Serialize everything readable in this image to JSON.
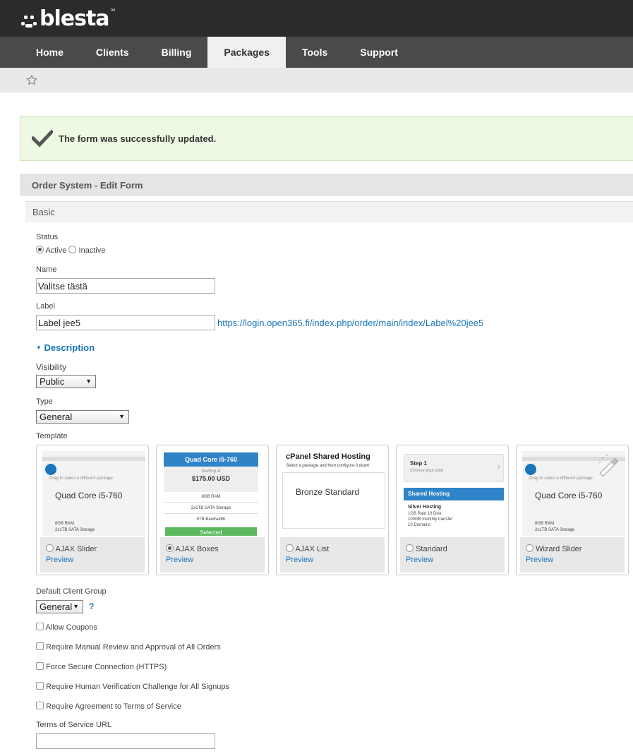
{
  "brand": {
    "name": "blesta",
    "tm": "™"
  },
  "nav": {
    "items": [
      "Home",
      "Clients",
      "Billing",
      "Packages",
      "Tools",
      "Support"
    ],
    "active": "Packages"
  },
  "alert": {
    "message": "The form was successfully updated."
  },
  "panel": {
    "title": "Order System - Edit Form",
    "section": "Basic"
  },
  "form": {
    "status": {
      "label": "Status",
      "options": [
        "Active",
        "Inactive"
      ],
      "selected": "Active"
    },
    "name": {
      "label": "Name",
      "value": "Valitse tästä"
    },
    "label": {
      "label": "Label",
      "value": "Label jee5",
      "url": "https://login.open365.fi/index.php/order/main/index/Label%20jee5"
    },
    "description_toggle": "Description",
    "visibility": {
      "label": "Visibility",
      "value": "Public"
    },
    "type": {
      "label": "Type",
      "value": "General"
    },
    "template": {
      "label": "Template",
      "selected": "AJAX Boxes",
      "preview_label": "Preview",
      "options": [
        "AJAX Slider",
        "AJAX Boxes",
        "AJAX List",
        "Standard",
        "Wizard Slider"
      ]
    },
    "client_group": {
      "label": "Default Client Group",
      "value": "General",
      "help": "?"
    },
    "checkboxes": [
      "Allow Coupons",
      "Require Manual Review and Approval of All Orders",
      "Force Secure Connection (HTTPS)",
      "Require Human Verification Challenge for All Signups",
      "Require Agreement to Terms of Service"
    ],
    "tos": {
      "label": "Terms of Service URL",
      "value": ""
    }
  },
  "thumbs": {
    "slider": {
      "hint": "Drag to select a different package.",
      "title": "Quad Core i5-760",
      "lines": [
        "8GB RAM",
        "2x1TB SATA Storage"
      ]
    },
    "boxes": {
      "title": "Quad Core i5-760",
      "starting": "Starting at",
      "price": "$175.00 USD",
      "lines": [
        "8GB RAM",
        "2x1TB SATA Storage",
        "5TB Bandwidth"
      ],
      "button": "Selected"
    },
    "list": {
      "title": "cPanel Shared Hosting",
      "subtitle": "Select a package and then configure it down",
      "item": "Bronze Standard"
    },
    "standard": {
      "step": "Step 1",
      "step_sub": "Choose your plan",
      "bar": "Shared Hosting",
      "plan": "Silver Hosting",
      "lines": [
        "1GB Raid 10 Disk",
        "100GB monthly transfer",
        "10 Domains"
      ]
    }
  },
  "colors": {
    "accent": "#1a75bb",
    "success_bg": "#eef9e3",
    "topbar": "#2b2b2b",
    "nav": "#4a4a4a",
    "green_button": "#5cb85c"
  }
}
